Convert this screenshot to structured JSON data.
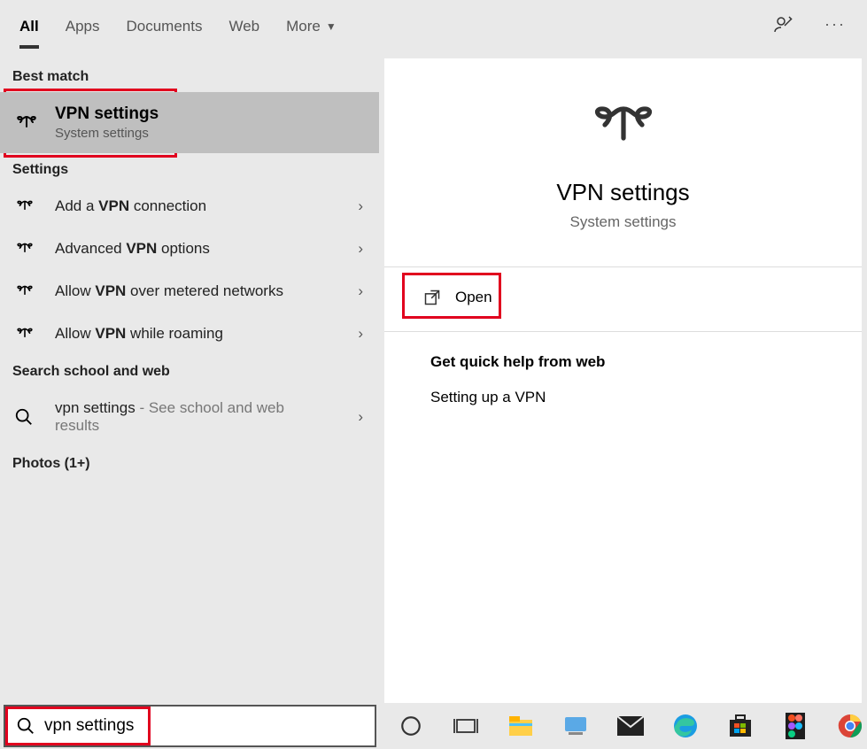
{
  "tabs": {
    "all": "All",
    "apps": "Apps",
    "documents": "Documents",
    "web": "Web",
    "more": "More"
  },
  "sections": {
    "best_match": "Best match",
    "settings": "Settings",
    "school_web": "Search school and web",
    "photos": "Photos (1+)"
  },
  "best_match": {
    "title": "VPN settings",
    "subtitle": "System settings"
  },
  "settings_items": [
    {
      "pre": "Add a ",
      "bold": "VPN",
      "post": " connection"
    },
    {
      "pre": "Advanced ",
      "bold": "VPN",
      "post": " options"
    },
    {
      "pre": "Allow ",
      "bold": "VPN",
      "post": " over metered networks"
    },
    {
      "pre": "Allow ",
      "bold": "VPN",
      "post": " while roaming"
    }
  ],
  "web_item": {
    "query": "vpn settings",
    "suffix": " - See school and web results"
  },
  "preview": {
    "title": "VPN settings",
    "subtitle": "System settings",
    "open": "Open",
    "help_header": "Get quick help from web",
    "help_item": "Setting up a VPN"
  },
  "search": {
    "value": "vpn settings"
  }
}
